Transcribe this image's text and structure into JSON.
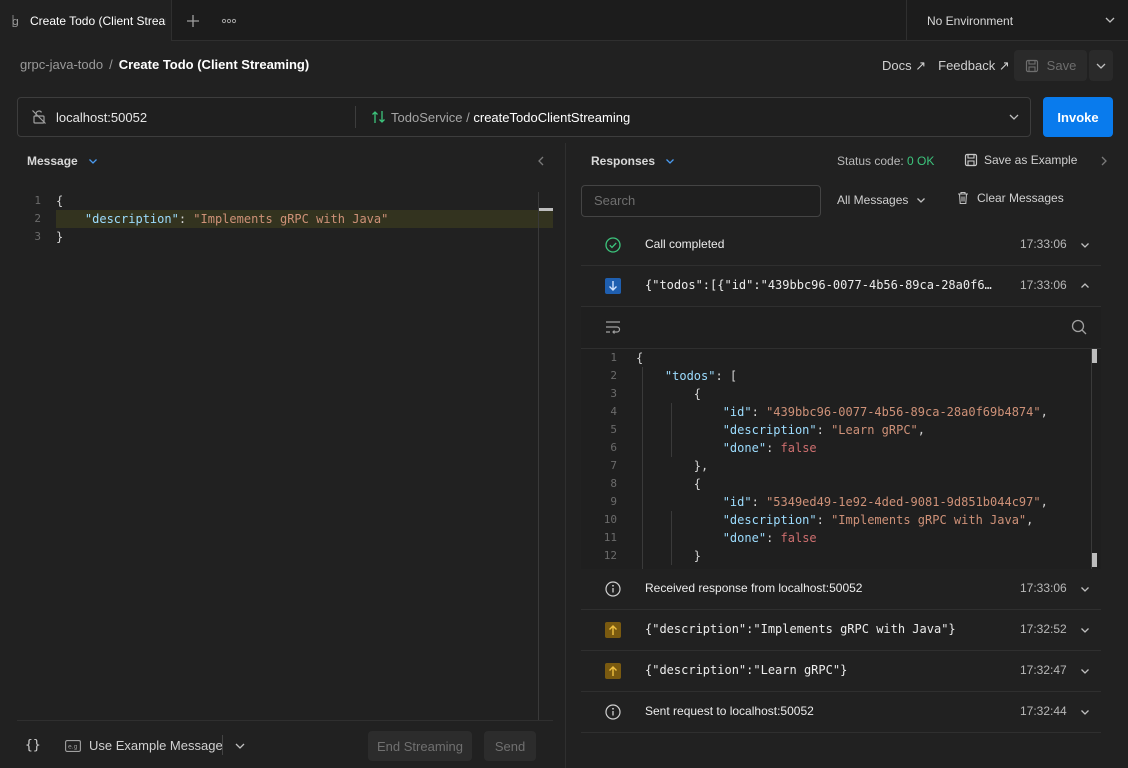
{
  "tab": {
    "title": "Create Todo (Client Streaming)"
  },
  "environment": {
    "label": "No Environment"
  },
  "breadcrumb": {
    "parent": "grpc-java-todo",
    "separator": "/",
    "current": "Create Todo (Client Streaming)"
  },
  "header": {
    "docs": "Docs ↗",
    "feedback": "Feedback ↗",
    "save": "Save"
  },
  "url": {
    "host": "localhost:50052",
    "service": "TodoService / ",
    "method": "createTodoClientStreaming",
    "invoke": "Invoke"
  },
  "message_panel": {
    "title": "Message",
    "line_numbers": [
      "1",
      "2",
      "3"
    ],
    "lines": [
      [
        {
          "t": "{",
          "c": "b"
        }
      ],
      [
        {
          "t": "    ",
          "c": "b"
        },
        {
          "t": "\"description\"",
          "c": "k"
        },
        {
          "t": ": ",
          "c": "b"
        },
        {
          "t": "\"Implements gRPC with Java\"",
          "c": "s"
        }
      ],
      [
        {
          "t": "}",
          "c": "b"
        }
      ]
    ]
  },
  "footer": {
    "braces": "{}",
    "use_example": "Use Example Message",
    "end_streaming": "End Streaming",
    "send": "Send"
  },
  "responses": {
    "title": "Responses",
    "status_label": "Status code: ",
    "status_value": "0 OK",
    "save_example": "Save as Example",
    "search_placeholder": "Search",
    "filter": "All Messages",
    "clear": "Clear Messages",
    "rows_top": [
      {
        "text": "Call completed",
        "time": "17:33:06",
        "icon": "check-circle-icon",
        "mono": false
      },
      {
        "text": "{\"todos\":[{\"id\":\"439bbc96-0077-4b56-89ca-28a0f6…",
        "time": "17:33:06",
        "icon": "arrow-down-icon",
        "mono": true
      }
    ],
    "rows_bottom": [
      {
        "text": "Received response from localhost:50052",
        "time": "17:33:06",
        "icon": "info-icon",
        "mono": false
      },
      {
        "text": "{\"description\":\"Implements gRPC with Java\"}",
        "time": "17:32:52",
        "icon": "arrow-up-icon",
        "mono": true
      },
      {
        "text": "{\"description\":\"Learn gRPC\"}",
        "time": "17:32:47",
        "icon": "arrow-up-icon",
        "mono": true
      },
      {
        "text": "Sent request to localhost:50052",
        "time": "17:32:44",
        "icon": "info-icon",
        "mono": false
      }
    ],
    "expanded_line_numbers": [
      "1",
      "2",
      "3",
      "4",
      "5",
      "6",
      "7",
      "8",
      "9",
      "10",
      "11",
      "12"
    ],
    "expanded_lines": [
      [
        {
          "t": "{",
          "c": "b"
        }
      ],
      [
        {
          "t": "    ",
          "c": "b"
        },
        {
          "t": "\"todos\"",
          "c": "k"
        },
        {
          "t": ": [",
          "c": "b"
        }
      ],
      [
        {
          "t": "        {",
          "c": "b"
        }
      ],
      [
        {
          "t": "            ",
          "c": "b"
        },
        {
          "t": "\"id\"",
          "c": "k"
        },
        {
          "t": ": ",
          "c": "b"
        },
        {
          "t": "\"439bbc96-0077-4b56-89ca-28a0f69b4874\"",
          "c": "s"
        },
        {
          "t": ",",
          "c": "b"
        }
      ],
      [
        {
          "t": "            ",
          "c": "b"
        },
        {
          "t": "\"description\"",
          "c": "k"
        },
        {
          "t": ": ",
          "c": "b"
        },
        {
          "t": "\"Learn gRPC\"",
          "c": "s"
        },
        {
          "t": ",",
          "c": "b"
        }
      ],
      [
        {
          "t": "            ",
          "c": "b"
        },
        {
          "t": "\"done\"",
          "c": "k"
        },
        {
          "t": ": ",
          "c": "b"
        },
        {
          "t": "false",
          "c": "f"
        }
      ],
      [
        {
          "t": "        },",
          "c": "b"
        }
      ],
      [
        {
          "t": "        {",
          "c": "b"
        }
      ],
      [
        {
          "t": "            ",
          "c": "b"
        },
        {
          "t": "\"id\"",
          "c": "k"
        },
        {
          "t": ": ",
          "c": "b"
        },
        {
          "t": "\"5349ed49-1e92-4ded-9081-9d851b044c97\"",
          "c": "s"
        },
        {
          "t": ",",
          "c": "b"
        }
      ],
      [
        {
          "t": "            ",
          "c": "b"
        },
        {
          "t": "\"description\"",
          "c": "k"
        },
        {
          "t": ": ",
          "c": "b"
        },
        {
          "t": "\"Implements gRPC with Java\"",
          "c": "s"
        },
        {
          "t": ",",
          "c": "b"
        }
      ],
      [
        {
          "t": "            ",
          "c": "b"
        },
        {
          "t": "\"done\"",
          "c": "k"
        },
        {
          "t": ": ",
          "c": "b"
        },
        {
          "t": "false",
          "c": "f"
        }
      ],
      [
        {
          "t": "        }",
          "c": "b"
        }
      ]
    ]
  },
  "colors": {
    "accent": "#097bed",
    "ok": "#3cc47c",
    "incoming": "#1f5fb0",
    "outgoing": "#b8860b"
  }
}
